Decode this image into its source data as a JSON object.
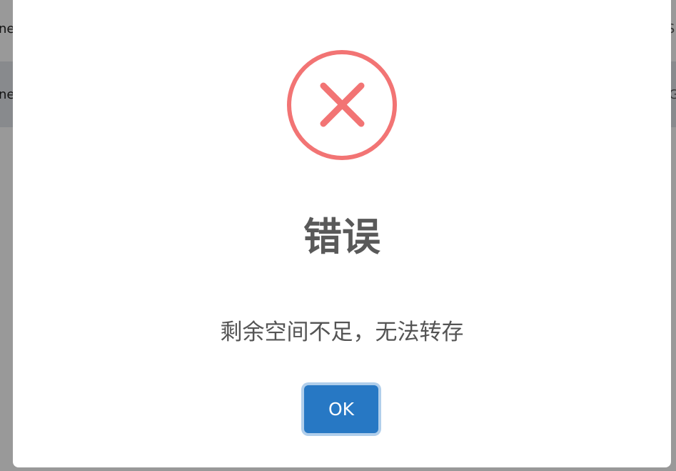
{
  "background": {
    "row1": {
      "left": "ne",
      "right": "S."
    },
    "row2": {
      "left": "ne",
      "right": "G"
    }
  },
  "dialog": {
    "icon": "error-x-icon",
    "title": "错误",
    "message": "剩余空间不足，无法转存",
    "ok_label": "OK"
  },
  "colors": {
    "icon": "#f27474",
    "button": "#2778c4",
    "title": "#595959",
    "message": "#545454",
    "overlay": "rgba(0,0,0,0.4)"
  }
}
